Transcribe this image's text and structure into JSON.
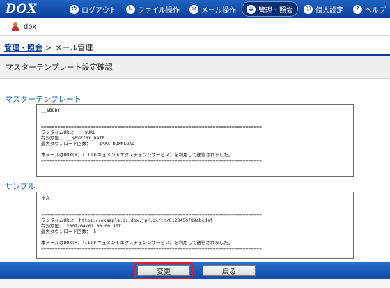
{
  "nav": {
    "logo": "DOX",
    "items": [
      {
        "label": "ログアウト",
        "icon": "logout-icon",
        "glyph": "⏻"
      },
      {
        "label": "ファイル操作",
        "icon": "file-ops-icon",
        "glyph": "↻"
      },
      {
        "label": "メール操作",
        "icon": "mail-icon",
        "glyph": "✉"
      },
      {
        "label": "管理・照会",
        "icon": "admin-icon",
        "glyph": "◒",
        "active": true
      },
      {
        "label": "個人設定",
        "icon": "person-icon",
        "glyph": "☺"
      },
      {
        "label": "ヘルプ",
        "icon": "help-icon",
        "glyph": "?"
      }
    ]
  },
  "user": {
    "name": "dox"
  },
  "breadcrumb": {
    "parent": "管理・照会",
    "separator": ">",
    "current": "メール管理"
  },
  "page_title": "マスターテンプレート設定確認",
  "master_template": {
    "label": "マスターテンプレート",
    "content": "__$BODY\n\n\n=================================================================================\nワンタイムURL： __$URL\n有効期限： __$EXPIRY_DATE\n最大ダウンロード回数： __$MAX_DOWNLOAD\n\n本メールはDOX(R)（IIJドキュメントエクスチェンジサービス）を利用して送信されました。\n================================================================================="
  },
  "sample": {
    "label": "サンプル",
    "content": "本文\n\n\n=================================================================================\nワンタイムURL： https://example.ds.dox.jp/.dx/tn/0123456789abcdef\n有効期限： 2007/04/01 00:00 JST\n最大ダウンロード回数： 5\n\n本メールはDOX(R)（IIJドキュメントエクスチェンジサービス）を利用して送信されました。\n================================================================================="
  },
  "buttons": {
    "change": "変更",
    "back": "戻る"
  },
  "colors": {
    "nav_blue": "#0a3f96",
    "section_blue": "#1a5fb4",
    "highlight_red": "#d9202a"
  }
}
